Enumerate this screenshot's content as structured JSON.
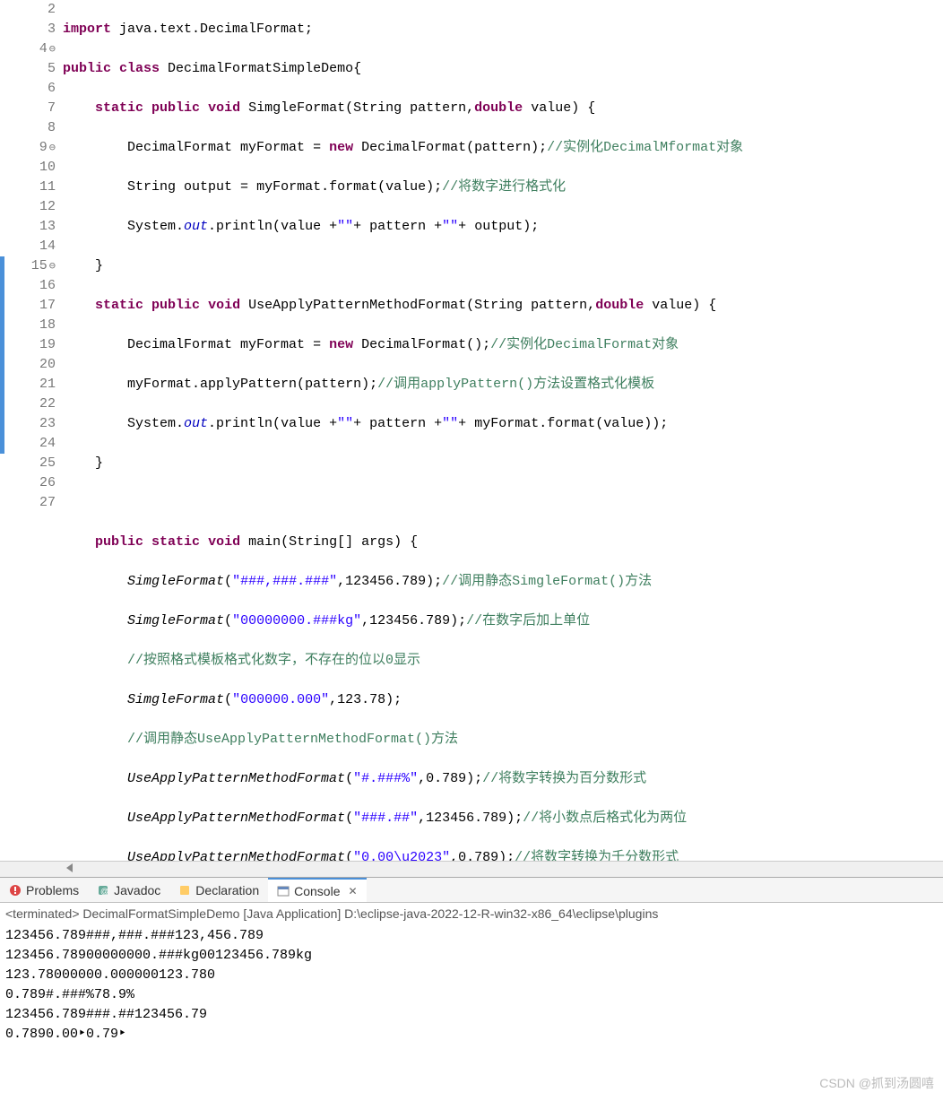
{
  "gutter": [
    {
      "n": "2",
      "marker": false,
      "anno": ""
    },
    {
      "n": "3",
      "marker": false,
      "anno": ""
    },
    {
      "n": "4",
      "marker": false,
      "anno": "⊖"
    },
    {
      "n": "5",
      "marker": false,
      "anno": ""
    },
    {
      "n": "6",
      "marker": false,
      "anno": ""
    },
    {
      "n": "7",
      "marker": false,
      "anno": ""
    },
    {
      "n": "8",
      "marker": false,
      "anno": ""
    },
    {
      "n": "9",
      "marker": false,
      "anno": "⊖"
    },
    {
      "n": "10",
      "marker": false,
      "anno": ""
    },
    {
      "n": "11",
      "marker": false,
      "anno": ""
    },
    {
      "n": "12",
      "marker": false,
      "anno": ""
    },
    {
      "n": "13",
      "marker": false,
      "anno": ""
    },
    {
      "n": "14",
      "marker": false,
      "anno": ""
    },
    {
      "n": "15",
      "marker": true,
      "anno": "⊖"
    },
    {
      "n": "16",
      "marker": true,
      "anno": ""
    },
    {
      "n": "17",
      "marker": true,
      "anno": ""
    },
    {
      "n": "18",
      "marker": true,
      "anno": ""
    },
    {
      "n": "19",
      "marker": true,
      "anno": ""
    },
    {
      "n": "20",
      "marker": true,
      "anno": ""
    },
    {
      "n": "21",
      "marker": true,
      "anno": ""
    },
    {
      "n": "22",
      "marker": true,
      "anno": ""
    },
    {
      "n": "23",
      "marker": true,
      "anno": ""
    },
    {
      "n": "24",
      "marker": true,
      "anno": ""
    },
    {
      "n": "25",
      "marker": false,
      "anno": ""
    },
    {
      "n": "26",
      "marker": false,
      "anno": ""
    },
    {
      "n": "27",
      "marker": false,
      "anno": ""
    }
  ],
  "code": {
    "l2": {
      "kw1": "import",
      "rest": " java.text.DecimalFormat;"
    },
    "l3": {
      "kw1": "public",
      "kw2": "class",
      "cls": " DecimalFormatSimpleDemo",
      "brace": "{"
    },
    "l4": {
      "pad": "    ",
      "kw1": "static",
      "kw2": "public",
      "kw3": "void",
      "mtd": " SimgleFormat",
      "sig1": "(String ",
      "p1": "pattern",
      "sig2": ",",
      "kw4": "double",
      "p2": " value",
      "sig3": ") {"
    },
    "l5": {
      "pad": "        ",
      "t1": "DecimalFormat ",
      "v1": "myFormat",
      "t2": " = ",
      "kw": "new",
      "t3": " DecimalFormat(",
      "p": "pattern",
      "t4": ");",
      "com": "//实例化DecimalMformat对象"
    },
    "l6": {
      "pad": "        ",
      "t1": "String ",
      "v1": "output",
      "t2": " = ",
      "v2": "myFormat",
      "t3": ".format(",
      "p": "value",
      "t4": ");",
      "com": "//将数字进行格式化"
    },
    "l7": {
      "pad": "        ",
      "t1": "System.",
      "fld": "out",
      "t2": ".println(",
      "p1": "value",
      "t3": " +",
      "s1": "\"\"",
      "t4": "+ ",
      "p2": "pattern",
      "t5": " +",
      "s2": "\"\"",
      "t6": "+ ",
      "p3": "output",
      "t7": ");"
    },
    "l8": {
      "pad": "    ",
      "brace": "}"
    },
    "l9": {
      "pad": "    ",
      "kw1": "static",
      "kw2": "public",
      "kw3": "void",
      "mtd": " UseApplyPatternMethodFormat",
      "sig1": "(String ",
      "p1": "pattern",
      "sig2": ",",
      "kw4": "double",
      "p2": " value",
      "sig3": ") {"
    },
    "l10": {
      "pad": "        ",
      "t1": "DecimalFormat ",
      "v1": "myFormat",
      "t2": " = ",
      "kw": "new",
      "t3": " DecimalFormat();",
      "com": "//实例化DecimalFormat对象"
    },
    "l11": {
      "pad": "        ",
      "v1": "myFormat",
      "t1": ".applyPattern(",
      "p": "pattern",
      "t2": ");",
      "com": "//调用applyPattern()方法设置格式化模板"
    },
    "l12": {
      "pad": "        ",
      "t1": "System.",
      "fld": "out",
      "t2": ".println(",
      "p1": "value",
      "t3": " +",
      "s1": "\"\"",
      "t4": "+ ",
      "p2": "pattern",
      "t5": " +",
      "s2": "\"\"",
      "t6": "+ ",
      "v": "myFormat",
      "t7": ".format(",
      "p3": "value",
      "t8": "));"
    },
    "l13": {
      "pad": "    ",
      "brace": "}"
    },
    "l14": {
      "pad": ""
    },
    "l15": {
      "pad": "    ",
      "kw1": "public",
      "kw2": "static",
      "kw3": "void",
      "mtd": " main",
      "sig1": "(String[] ",
      "p1": "args",
      "sig2": ") {"
    },
    "l16": {
      "pad": "        ",
      "mtd": "SimgleFormat",
      "t1": "(",
      "s": "\"###,###.###\"",
      "t2": ",123456.789);",
      "com": "//调用静态SimgleFormat()方法"
    },
    "l17": {
      "pad": "        ",
      "mtd": "SimgleFormat",
      "t1": "(",
      "s": "\"00000000.###kg\"",
      "t2": ",123456.789);",
      "com": "//在数字后加上单位"
    },
    "l18": {
      "pad": "        ",
      "com": "//按照格式模板格式化数字，不存在的位以0显示"
    },
    "l19": {
      "pad": "        ",
      "mtd": "SimgleFormat",
      "t1": "(",
      "s": "\"000000.000\"",
      "t2": ",123.78);"
    },
    "l20": {
      "pad": "        ",
      "com": "//调用静态UseApplyPatternMethodFormat()方法"
    },
    "l21": {
      "pad": "        ",
      "mtd": "UseApplyPatternMethodFormat",
      "t1": "(",
      "s": "\"#.###%\"",
      "t2": ",0.789);",
      "com": "//将数字转换为百分数形式"
    },
    "l22": {
      "pad": "        ",
      "mtd": "UseApplyPatternMethodFormat",
      "t1": "(",
      "s": "\"###.##\"",
      "t2": ",123456.789);",
      "com": "//将小数点后格式化为两位"
    },
    "l23": {
      "pad": "        ",
      "mtd": "UseApplyPatternMethodFormat",
      "t1": "(",
      "s": "\"0.00\\u2023\"",
      "t2": ",0.789);",
      "com": "//将数字转换为千分数形式"
    },
    "l24": {
      "pad": "    ",
      "brace": "}"
    },
    "l25": {
      "pad": ""
    },
    "l26": {
      "brace": "}"
    },
    "l27": {
      "pad": ""
    }
  },
  "tabs": {
    "problems": "Problems",
    "javadoc": "Javadoc",
    "declaration": "Declaration",
    "console": "Console"
  },
  "console": {
    "header": "<terminated> DecimalFormatSimpleDemo [Java Application] D:\\eclipse-java-2022-12-R-win32-x86_64\\eclipse\\plugins",
    "lines": [
      "123456.789###,###.###123,456.789",
      "123456.78900000000.###kg00123456.789kg",
      "123.78000000.000000123.780",
      "0.789#.###%78.9%",
      "123456.789###.##123456.79",
      "0.7890.00‣0.79‣"
    ]
  },
  "watermark": "CSDN @抓到汤圆嘻"
}
